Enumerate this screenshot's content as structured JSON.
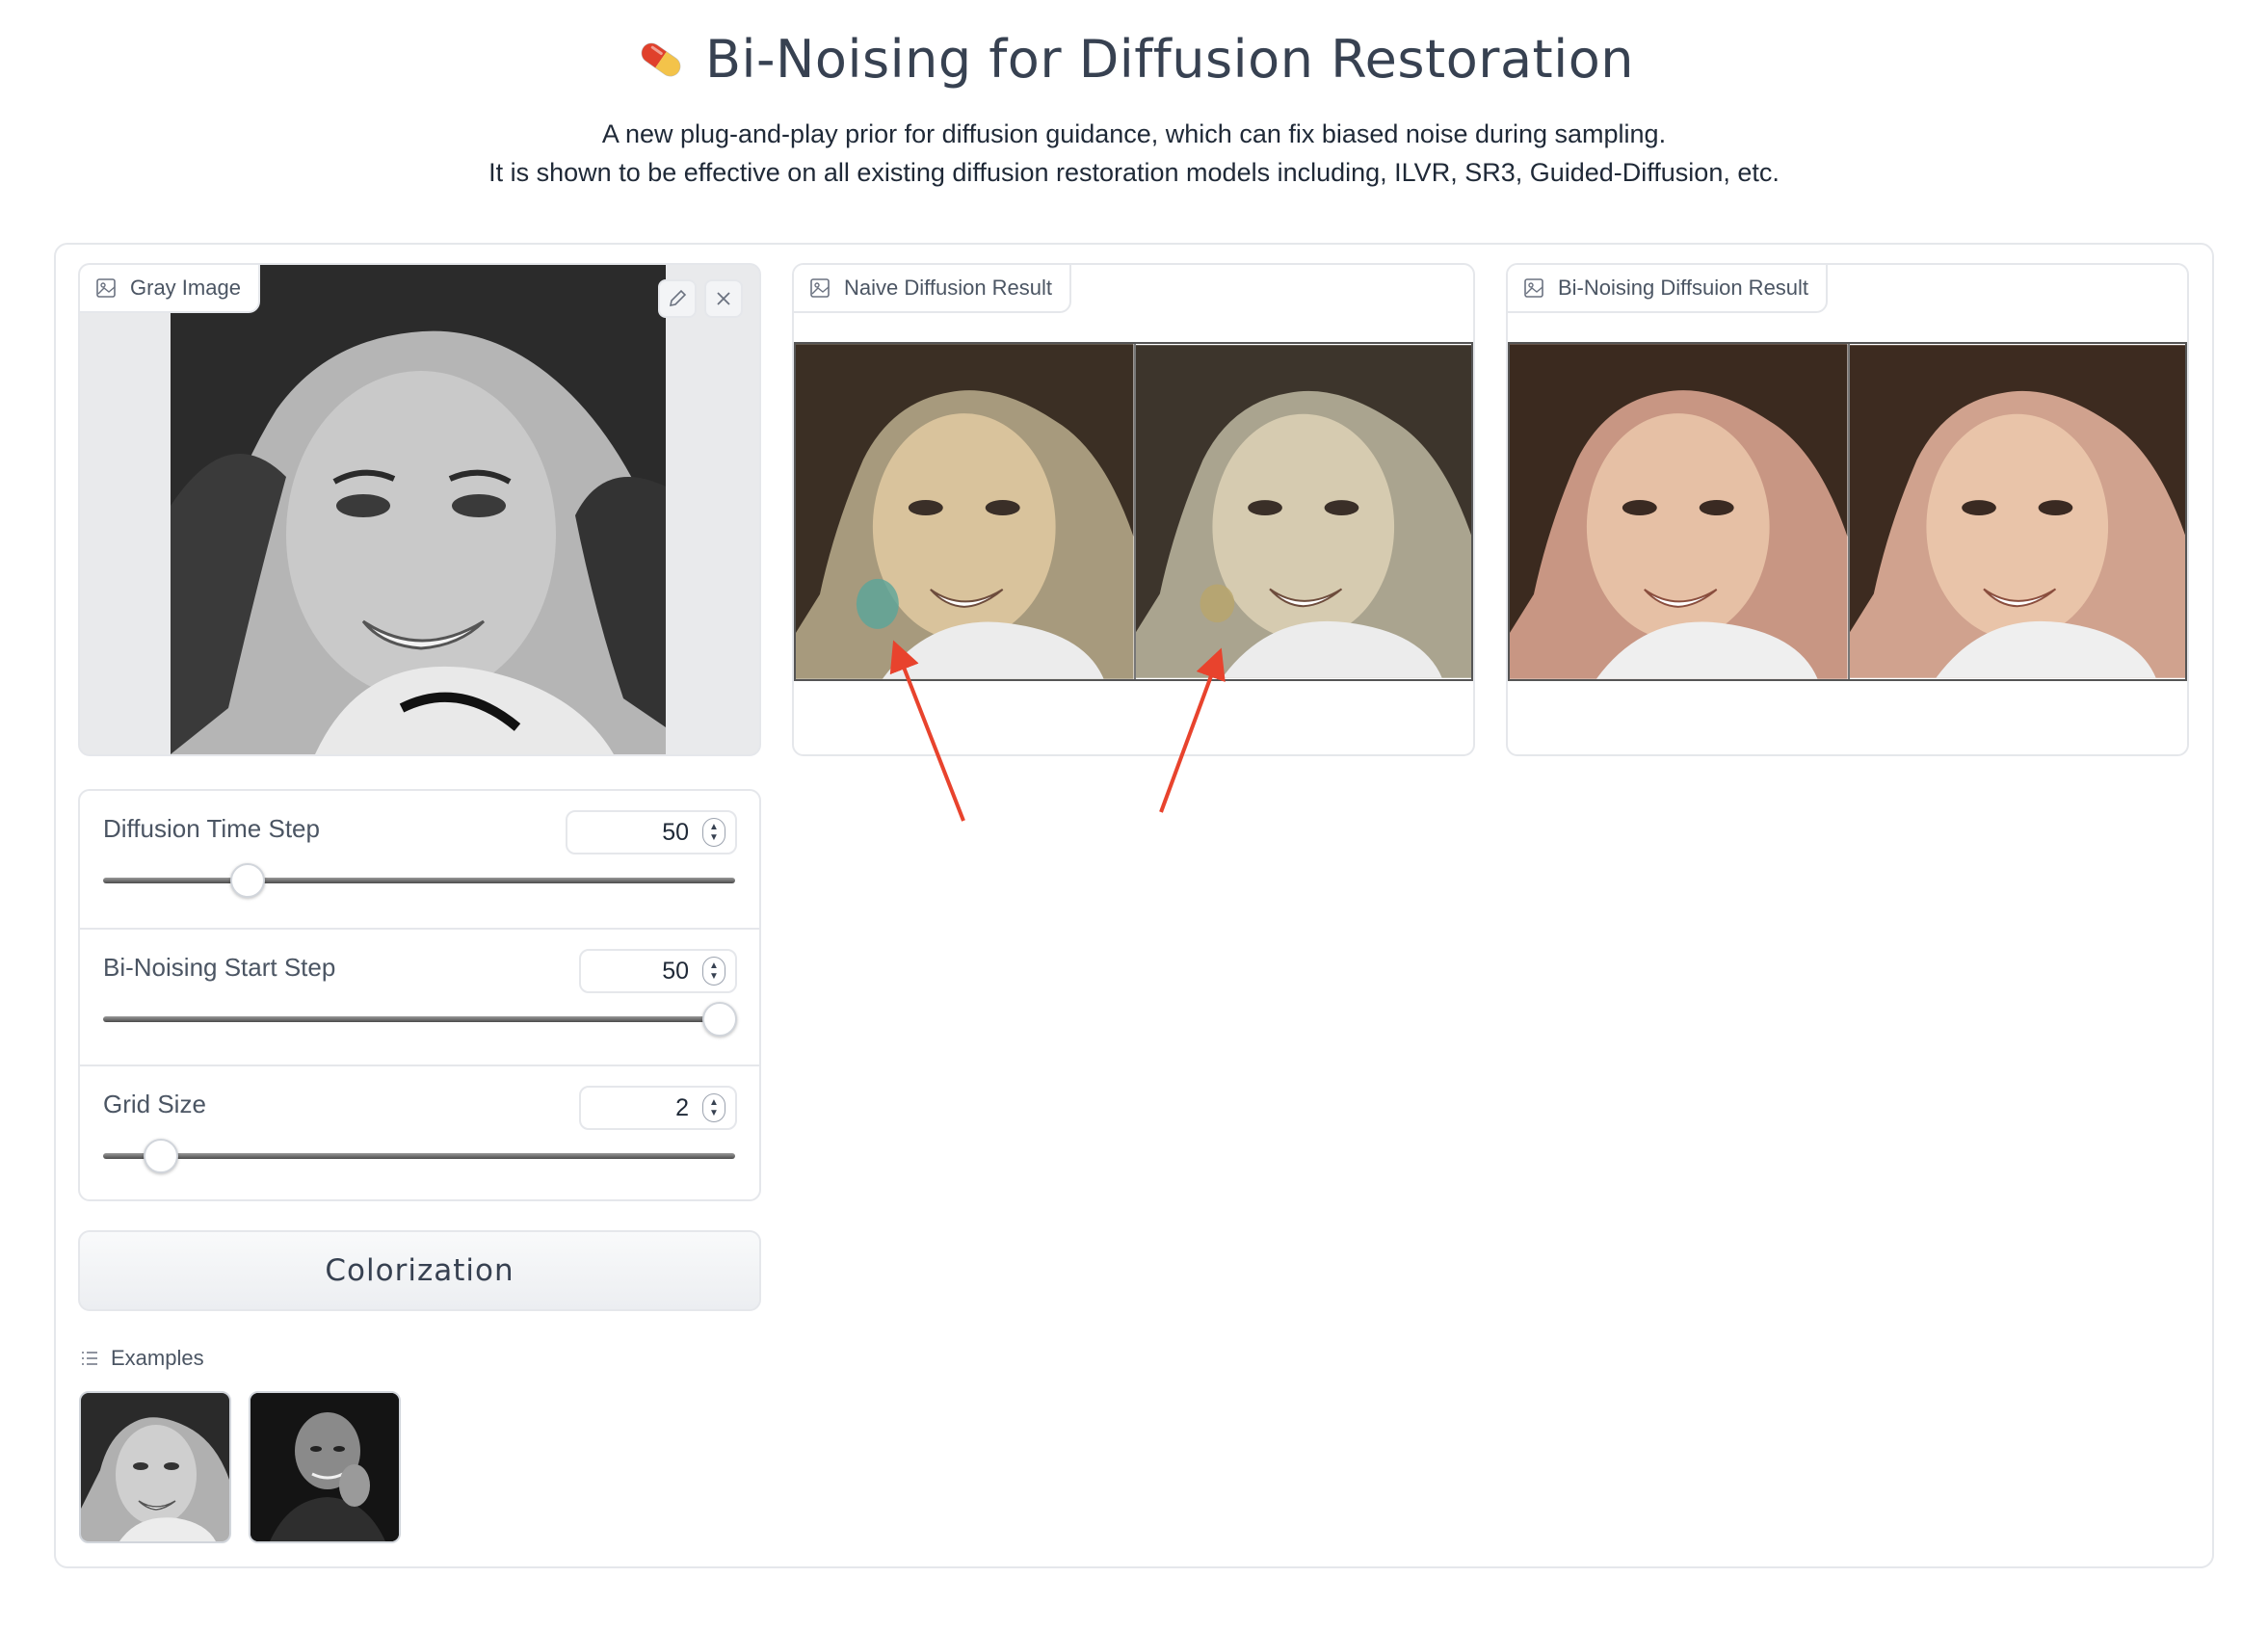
{
  "header": {
    "title": "Bi-Noising for Diffusion Restoration",
    "subtitle_line1": "A new plug-and-play prior for diffusion guidance, which can fix biased noise during sampling.",
    "subtitle_line2": "It is shown to be effective on all existing diffusion restoration models including, ILVR, SR3, Guided-Diffusion, etc."
  },
  "inputs": {
    "gray_image_label": "Gray Image"
  },
  "outputs": {
    "naive_label": "Naive Diffusion Result",
    "binoising_label": "Bi-Noising Diffsuion Result"
  },
  "sliders": [
    {
      "label": "Diffusion Time Step",
      "value": "50",
      "level": 0.22
    },
    {
      "label": "Bi-Noising Start Step",
      "value": "50",
      "level": 1.0
    },
    {
      "label": "Grid Size",
      "value": "2",
      "level": 0.09
    }
  ],
  "button": {
    "label": "Colorization"
  },
  "examples": {
    "label": "Examples"
  },
  "colors": {
    "accent_arrow": "#e8432d",
    "border": "#e5e7eb"
  }
}
